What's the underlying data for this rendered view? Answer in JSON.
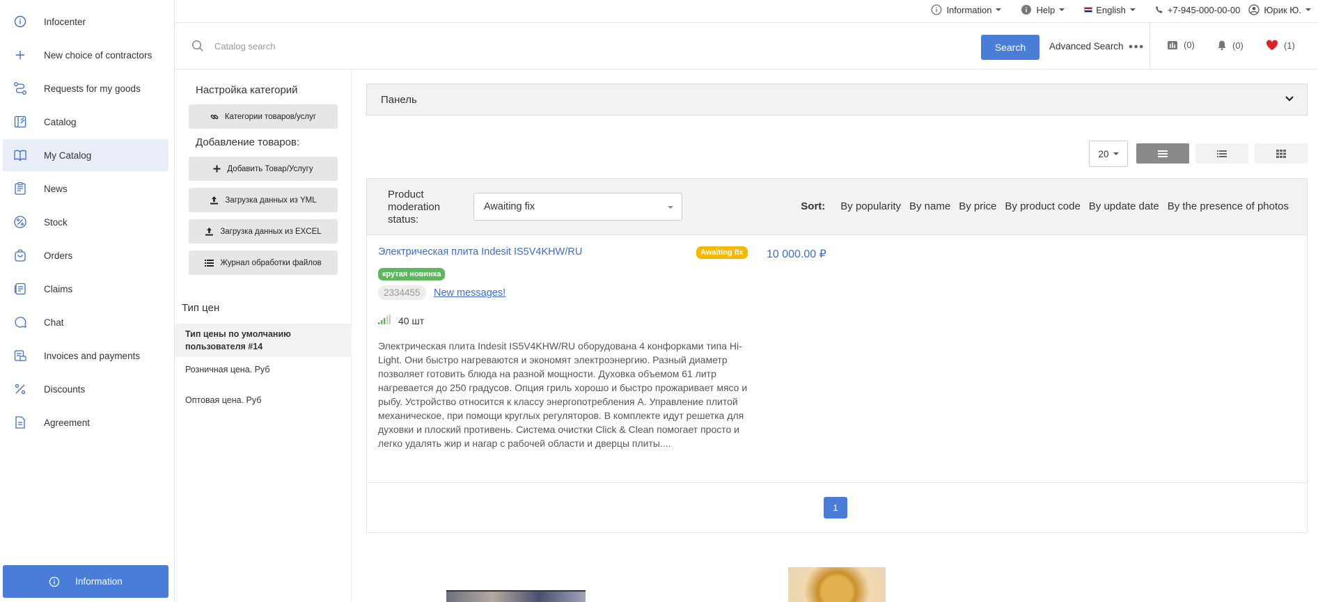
{
  "sidebar": {
    "items": [
      {
        "label": "Infocenter",
        "icon": "info-icon",
        "active": false
      },
      {
        "label": "New choice of contractors",
        "icon": "plus-icon",
        "active": false
      },
      {
        "label": "Requests for my goods",
        "icon": "route-icon",
        "active": false
      },
      {
        "label": "Catalog",
        "icon": "catalog-icon",
        "active": false
      },
      {
        "label": "My Catalog",
        "icon": "book-icon",
        "active": true
      },
      {
        "label": "News",
        "icon": "news-icon",
        "active": false
      },
      {
        "label": "Stock",
        "icon": "percent-circle-icon",
        "active": false
      },
      {
        "label": "Orders",
        "icon": "bag-icon",
        "active": false
      },
      {
        "label": "Claims",
        "icon": "claims-icon",
        "active": false
      },
      {
        "label": "Chat",
        "icon": "chat-icon",
        "active": false
      },
      {
        "label": "Invoices and payments",
        "icon": "invoice-icon",
        "active": false
      },
      {
        "label": "Discounts",
        "icon": "percent-icon",
        "active": false
      },
      {
        "label": "Agreement",
        "icon": "document-icon",
        "active": false
      }
    ],
    "info_button": "Information"
  },
  "topbar": {
    "information": "Information",
    "help": "Help",
    "language": "English",
    "phone": "+7-945-000-00-00",
    "user": "Юрик Ю."
  },
  "search": {
    "placeholder": "Catalog search",
    "button": "Search",
    "advanced": "Advanced Search",
    "compare_count": "(0)",
    "notifications_count": "(0)",
    "favorites_count": "(1)"
  },
  "midcol": {
    "categories_heading": "Настройка категорий",
    "categories_button": "Категории товаров/услуг",
    "add_heading": "Добавление товаров:",
    "add_button": "Добавить Товар/Услугу",
    "yml_button": "Загрузка данных из YML",
    "excel_button": "Загрузка данных из EXCEL",
    "log_button": "Журнал обработки файлов",
    "price_types_heading": "Тип цен",
    "price_types": [
      {
        "label": "Тип цены по умолчанию пользователя #14",
        "active": true
      },
      {
        "label": "Розничная цена. Руб",
        "active": false
      },
      {
        "label": "Оптовая цена. Руб",
        "active": false
      }
    ]
  },
  "main": {
    "panel_title": "Панель",
    "per_page": "20",
    "filter": {
      "label": "Product moderation status:",
      "selected": "Awaiting fix"
    },
    "sort": {
      "label": "Sort:",
      "options": [
        "By popularity",
        "By name",
        "By price",
        "By product code",
        "By update date",
        "By the presence of photos"
      ]
    },
    "product": {
      "title": "Электрическая плита Indesit IS5V4KHW/RU",
      "status": "Awaiting fix",
      "price": "10 000.00 ₽",
      "tag": "крутая новинка",
      "sku": "2334455",
      "messages_link": "New messages!",
      "stock": "40 шт",
      "description": "Электрическая плита Indesit IS5V4KHW/RU оборудована 4 конфорками типа Hi-Light. Они быстро нагреваются и экономят электроэнергию. Разный диаметр позволяет готовить блюда на разной мощности. Духовка объемом 61 литр нагревается до 250 градусов. Опция гриль хорошо и быстро прожаривает мясо и рыбу. Устройство относится к классу энергопотребления А. Управление плитой механическое, при помощи круглых регуляторов. В комплекте идут решетка для духовки и плоский противень. Система очистки Click & Clean помогает просто и легко удалять жир и нагар с рабочей области и дверцы плиты...."
    },
    "pagination": {
      "current": "1"
    }
  },
  "colors": {
    "accent": "#4a7dd8",
    "link": "#3d6cc4",
    "status_yellow": "#f5b800",
    "tag_green": "#5cb85c"
  }
}
